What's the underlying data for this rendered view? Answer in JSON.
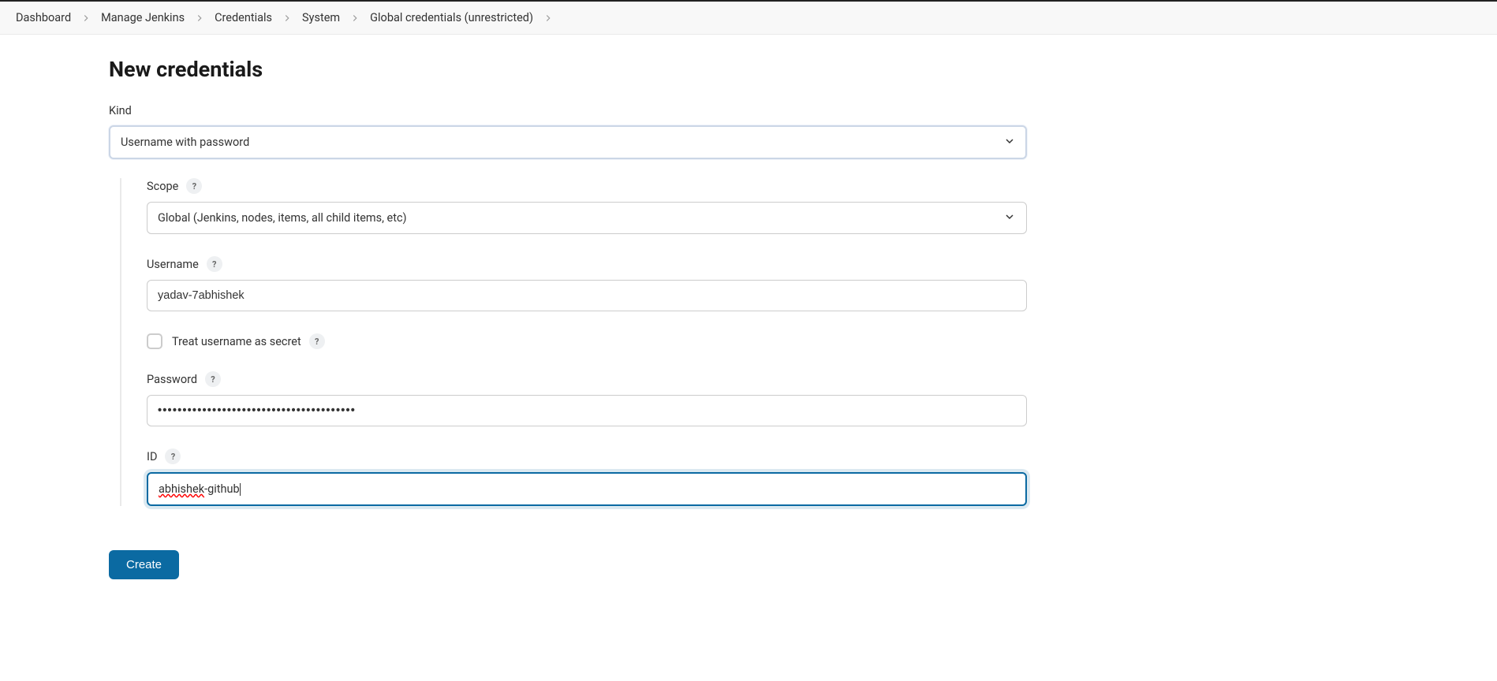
{
  "breadcrumbs": [
    {
      "label": "Dashboard"
    },
    {
      "label": "Manage Jenkins"
    },
    {
      "label": "Credentials"
    },
    {
      "label": "System"
    },
    {
      "label": "Global credentials (unrestricted)"
    }
  ],
  "page": {
    "title": "New credentials"
  },
  "form": {
    "kind": {
      "label": "Kind",
      "value": "Username with password"
    },
    "scope": {
      "label": "Scope",
      "value": "Global (Jenkins, nodes, items, all child items, etc)"
    },
    "username": {
      "label": "Username",
      "value": "yadav-7abhishek"
    },
    "treat_secret": {
      "label": "Treat username as secret",
      "checked": false
    },
    "password": {
      "label": "Password",
      "value": "••••••••••••••••••••••••••••••••••••••••"
    },
    "id": {
      "label": "ID",
      "value_prefix": "abhishek",
      "value_suffix": "-github"
    }
  },
  "buttons": {
    "create": "Create"
  },
  "help_tooltip": "?"
}
